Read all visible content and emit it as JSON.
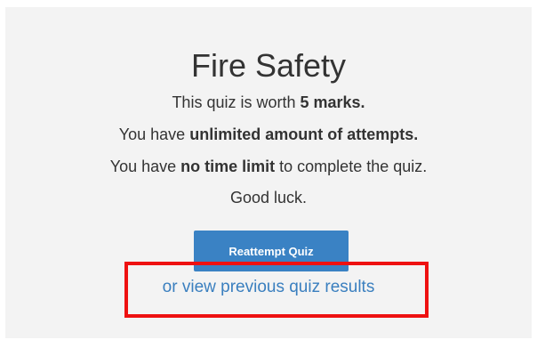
{
  "quiz": {
    "title": "Fire Safety",
    "line1_pre": "This quiz is worth ",
    "line1_bold": "5 marks.",
    "line2_pre": "You have ",
    "line2_bold": "unlimited amount of attempts.",
    "line3_pre": "You have ",
    "line3_bold": "no time limit",
    "line3_post": " to complete the quiz.",
    "line4": "Good luck."
  },
  "actions": {
    "reattempt_label": "Reattempt Quiz",
    "view_results_label": "or view previous quiz results"
  },
  "colors": {
    "panel_bg": "#f3f3f3",
    "button_bg": "#3a82c4",
    "link": "#3a7fbf",
    "highlight": "#ee1111"
  }
}
